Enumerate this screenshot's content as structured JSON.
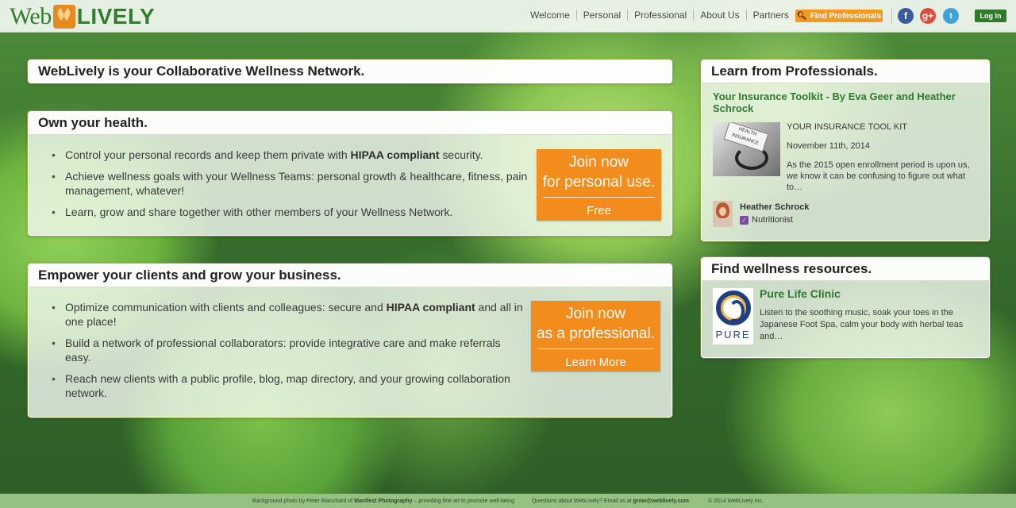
{
  "logo": {
    "left": "Web",
    "right": "LIVELY"
  },
  "nav": {
    "items": [
      "Welcome",
      "Personal",
      "Professional",
      "About Us",
      "Partners"
    ],
    "find_professionals": "Find Professionals",
    "login": "Log In"
  },
  "social": {
    "facebook": "f",
    "googleplus": "g+",
    "twitter": "t"
  },
  "tagline": "WebLively is your Collaborative Wellness Network.",
  "own_health": {
    "title": "Own your health.",
    "bullets": [
      {
        "pre": "Control your personal records and keep them private with ",
        "bold": "HIPAA compliant",
        "post": " security."
      },
      {
        "pre": "Achieve wellness goals with your Wellness Teams: personal growth & healthcare, fitness, pain management, whatever!",
        "bold": "",
        "post": ""
      },
      {
        "pre": "Learn, grow and share together with other members of your Wellness Network.",
        "bold": "",
        "post": ""
      }
    ],
    "cta_line1": "Join now",
    "cta_line2": "for personal use.",
    "cta_sub": "Free"
  },
  "empower": {
    "title": "Empower your clients and grow your business.",
    "bullets": [
      {
        "pre": "Optimize communication with clients and colleagues: secure and ",
        "bold": "HIPAA compliant",
        "post": " and all in one place!"
      },
      {
        "pre": "Build a network of professional collaborators: provide integrative care and make referrals easy.",
        "bold": "",
        "post": ""
      },
      {
        "pre": "Reach new clients with a public profile, blog, map directory, and your growing collaboration network.",
        "bold": "",
        "post": ""
      }
    ],
    "cta_line1": "Join now",
    "cta_line2": "as a professional.",
    "cta_sub": "Learn More"
  },
  "learn": {
    "title": "Learn from Professionals.",
    "article_title": "Your Insurance Toolkit - By Eva Geer and Heather Schrock",
    "thumb_text": "HEALTH INSURANCE",
    "kit": "YOUR INSURANCE TOOL KIT",
    "date": "November 11th, 2014",
    "excerpt": "As the 2015 open enrollment period is upon us, we know it can be confusing to figure out what to…",
    "author": "Heather Schrock",
    "role": "Nutritionist"
  },
  "resources": {
    "title": "Find wellness resources.",
    "name": "Pure Life Clinic",
    "logo_text": "PURE",
    "description": "Listen to the soothing music, soak your toes in the Japanese Foot Spa, calm your body with herbal teas and…"
  },
  "footer": {
    "credit_pre": "Background photo by Peter Blanchard of ",
    "credit_bold": "Manifest Photography",
    "credit_post": " – providing fine art to promote well-being",
    "questions_pre": "Questions about WebLively? Email us at ",
    "questions_email": "grow@weblively.com",
    "questions_post": ".",
    "copyright": "© 2014 WebLively Inc."
  }
}
